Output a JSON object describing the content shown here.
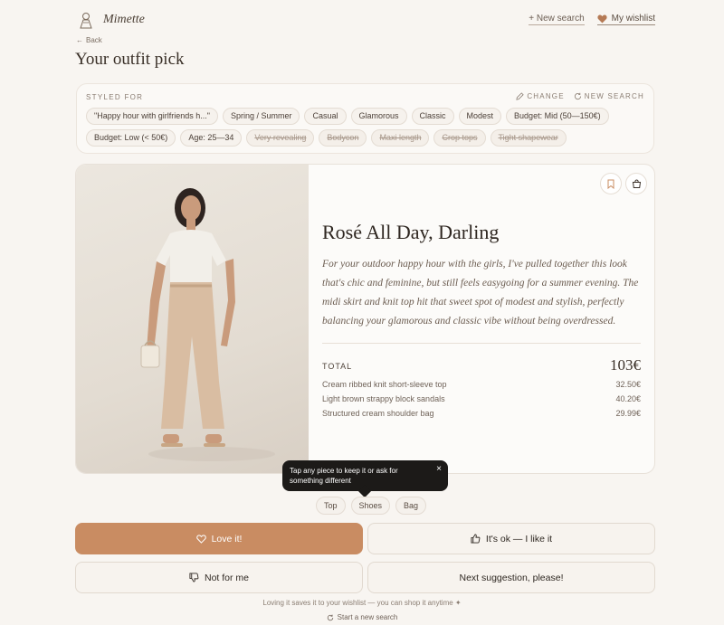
{
  "header": {
    "brand": "Mimette",
    "new_search": "+ New search",
    "wishlist": "My wishlist"
  },
  "nav": {
    "back": "Back"
  },
  "page_title": "Your outfit pick",
  "styled_for": {
    "label": "STYLED FOR",
    "change": "CHANGE",
    "new_search": "NEW SEARCH",
    "chips_row1": [
      "\"Happy hour with girlfriends h...\"",
      "Spring / Summer",
      "Casual",
      "Glamorous",
      "Classic",
      "Modest",
      "Budget: Mid (50—150€)"
    ],
    "chips_row2": [
      "Budget: Low (< 50€)",
      "Age: 25—34"
    ],
    "excluded": [
      "Very revealing",
      "Bodycon",
      "Maxi length",
      "Crop tops",
      "Tight shapewear"
    ]
  },
  "outfit": {
    "title": "Rosé All Day, Darling",
    "description": "For your outdoor happy hour with the girls, I've pulled together this look that's chic and feminine, but still feels easygoing for a summer evening. The midi skirt and knit top hit that sweet spot of modest and stylish, perfectly balancing your glamorous and classic vibe without being overdressed.",
    "total_label": "TOTAL",
    "total_value": "103€",
    "items": [
      {
        "name": "Cream ribbed knit short-sleeve top",
        "price": "32.50€"
      },
      {
        "name": "Light brown strappy block sandals",
        "price": "40.20€"
      },
      {
        "name": "Structured cream shoulder bag",
        "price": "29.99€"
      }
    ]
  },
  "tooltip": {
    "text": "Tap any piece to keep it or ask for something different",
    "close": "×"
  },
  "pieces": [
    "Top",
    "Shoes",
    "Bag"
  ],
  "actions": {
    "love": "Love it!",
    "ok": "It's ok — I like it",
    "not_for_me": "Not for me",
    "next": "Next suggestion, please!"
  },
  "footer": {
    "note": "Loving it saves it to your wishlist — you can shop it anytime ✦",
    "new_search": "Start a new search"
  },
  "colors": {
    "accent": "#c98c62",
    "background": "#f8f5f1",
    "heart": "#b57a55"
  },
  "icons": [
    "bookmark-icon",
    "cart-icon",
    "heart-icon",
    "thumbs-up-icon",
    "thumbs-down-icon",
    "pencil-icon",
    "refresh-icon",
    "arrow-left-icon"
  ]
}
